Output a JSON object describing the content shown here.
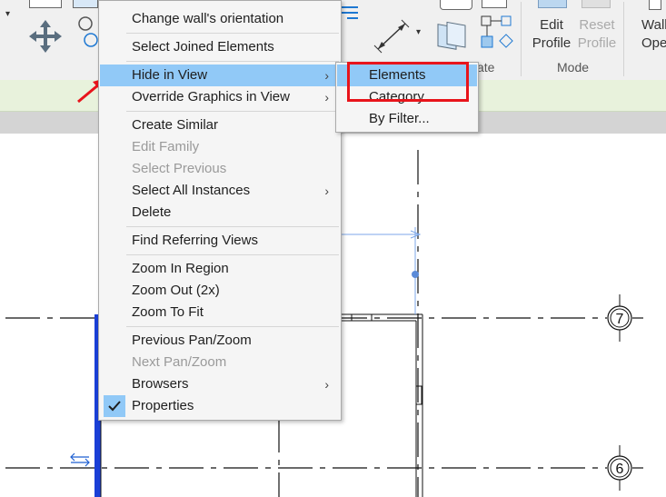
{
  "ribbon": {
    "edit_profile": "Edit\nProfile",
    "reset_profile": "Reset\nProfile",
    "wall_opening": "Wall\nOpening",
    "panel_mode": "Mode",
    "panel_create_partial": "ate"
  },
  "context_menu": {
    "items": [
      {
        "label": "Change wall's orientation"
      },
      {
        "label": "Select Joined Elements"
      },
      {
        "label": "Hide in View",
        "submenu": true
      },
      {
        "label": "Override Graphics in View",
        "submenu": true
      },
      {
        "label": "Create Similar"
      },
      {
        "label": "Edit Family",
        "disabled": true
      },
      {
        "label": "Select Previous",
        "disabled": true
      },
      {
        "label": "Select All Instances",
        "submenu": true
      },
      {
        "label": "Delete"
      },
      {
        "label": "Find Referring Views"
      },
      {
        "label": "Zoom In Region"
      },
      {
        "label": "Zoom Out (2x)"
      },
      {
        "label": "Zoom To Fit"
      },
      {
        "label": "Previous Pan/Zoom"
      },
      {
        "label": "Next Pan/Zoom",
        "disabled": true
      },
      {
        "label": "Browsers",
        "submenu": true
      },
      {
        "label": "Properties",
        "checked": true
      }
    ],
    "submenu_arrow": "›"
  },
  "submenu": {
    "items": [
      "Elements",
      "Category",
      "By Filter..."
    ]
  },
  "grid": {
    "bubble_7": "7",
    "bubble_6": "6"
  },
  "colors": {
    "highlight": "#91c9f7",
    "annotation_red": "#e8141b"
  }
}
